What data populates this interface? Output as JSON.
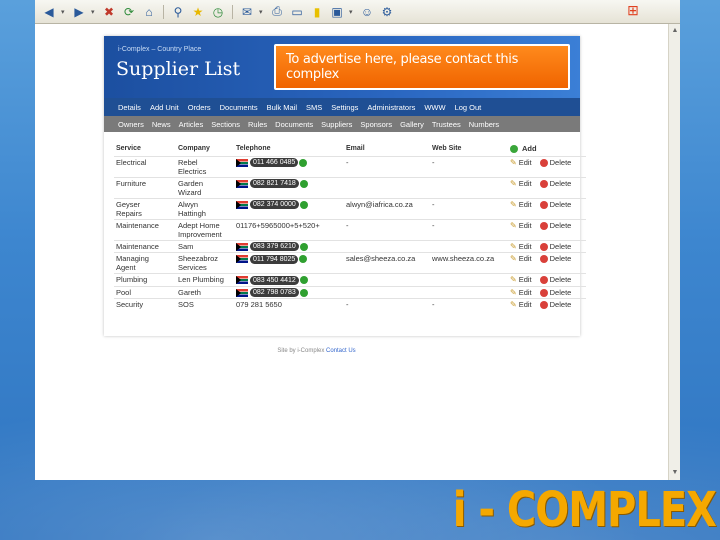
{
  "toolbar": {
    "icons": [
      "back-icon",
      "forward-icon",
      "stop-icon",
      "refresh-icon",
      "home-icon",
      "search-icon",
      "favorites-icon",
      "history-icon",
      "mail-icon",
      "print-icon",
      "edit-icon",
      "discuss-icon",
      "research-icon",
      "messenger-icon",
      "tools-icon"
    ]
  },
  "header": {
    "breadcrumb": "i-Complex – Country Place",
    "title": "Supplier List",
    "ad_text": "To advertise here, please contact this complex"
  },
  "nav_primary": [
    "Details",
    "Add Unit",
    "Orders",
    "Documents",
    "Bulk Mail",
    "SMS",
    "Settings",
    "Administrators",
    "WWW",
    "Log Out"
  ],
  "nav_secondary": [
    "Owners",
    "News",
    "Articles",
    "Sections",
    "Rules",
    "Documents",
    "Suppliers",
    "Sponsors",
    "Gallery",
    "Trustees",
    "Numbers"
  ],
  "table": {
    "headers": [
      "Service",
      "Company",
      "Telephone",
      "Email",
      "Web Site"
    ],
    "add_label": "Add",
    "edit_label": "Edit",
    "delete_label": "Delete",
    "rows": [
      {
        "service": "Electrical",
        "company": "Rebel\nElectrics",
        "phone": "011 466 0485",
        "chip": true,
        "email": "-",
        "web": "-"
      },
      {
        "service": "Furniture",
        "company": "Garden\nWizard",
        "phone": "082 821 7418",
        "chip": true,
        "email": "",
        "web": ""
      },
      {
        "service": "Geyser\nRepairs",
        "company": "Alwyn\nHattingh",
        "phone": "082 374 0000",
        "chip": true,
        "email": "alwyn@iafrica.co.za",
        "web": "-"
      },
      {
        "service": "Maintenance",
        "company": "Adept Home\nImprovement",
        "phone": "01176+5965000+5+520+",
        "chip": false,
        "email": "-",
        "web": "-"
      },
      {
        "service": "Maintenance",
        "company": "Sam",
        "phone": "083 379 6210",
        "chip": true,
        "email": "",
        "web": ""
      },
      {
        "service": "Managing\nAgent",
        "company": "Sheezabroz\nServices",
        "phone": "011 794 8025",
        "chip": true,
        "email": "sales@sheeza.co.za",
        "web": "www.sheeza.co.za"
      },
      {
        "service": "Plumbing",
        "company": "Len Plumbing",
        "phone": "083 450 4412",
        "chip": true,
        "email": "",
        "web": ""
      },
      {
        "service": "Pool",
        "company": "Gareth",
        "phone": "082 798 0783",
        "chip": true,
        "email": "",
        "web": ""
      },
      {
        "service": "Security",
        "company": "SOS",
        "phone": "079 281 5650",
        "chip": false,
        "email": "-",
        "web": "-"
      }
    ]
  },
  "footer": {
    "text": "Site by i-Complex",
    "link": "Contact Us"
  },
  "brand": "i - COMPLEX",
  "colors": {
    "banner": "#1c4fa0",
    "ad": "#f06400",
    "nav_primary": "#1f4f94",
    "nav_secondary": "#7a7a7a",
    "brand": "#f5a800"
  }
}
